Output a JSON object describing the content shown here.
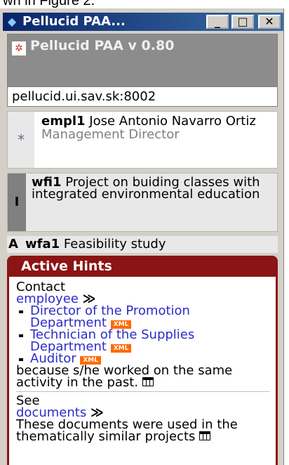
{
  "page_caption": "wn in Figure 2.",
  "window": {
    "title": "Pellucid PAA...",
    "minimize_label": "_",
    "maximize_label": "□",
    "close_label": "✕"
  },
  "app": {
    "name": "Pellucid PAA v 0.80",
    "server": "pellucid.ui.sav.sk:8002"
  },
  "employee": {
    "marker": "*",
    "id": "empl1",
    "name": "Jose Antonio Navarro Ortiz",
    "role": "Management Director"
  },
  "workflow_instance": {
    "marker": "I",
    "id": "wfi1",
    "description": "Project on buiding classes with integrated environmental education"
  },
  "workflow_activity": {
    "marker": "A",
    "id": "wfa1",
    "description": "Feasibility study"
  },
  "hints": {
    "header": "Active Hints",
    "contact": {
      "intro": "Contact",
      "link": "employee",
      "arrow": "≫",
      "items": [
        {
          "label": "Director of the Promotion Department",
          "badge": "XML"
        },
        {
          "label": "Technician of the Supplies Department",
          "badge": "XML"
        },
        {
          "label": "Auditor",
          "badge": "XML"
        }
      ],
      "reason": "because s/he worked on the same activity in the past."
    },
    "documents": {
      "intro": "See",
      "link": "documents",
      "arrow": "≫",
      "reason": "These documents were used in the thematically similar projects"
    }
  },
  "colors": {
    "hint_border": "#8b1414",
    "link": "#2b2bc8",
    "xml_badge": "#ff6a00",
    "titlebar": "#0a246a"
  }
}
